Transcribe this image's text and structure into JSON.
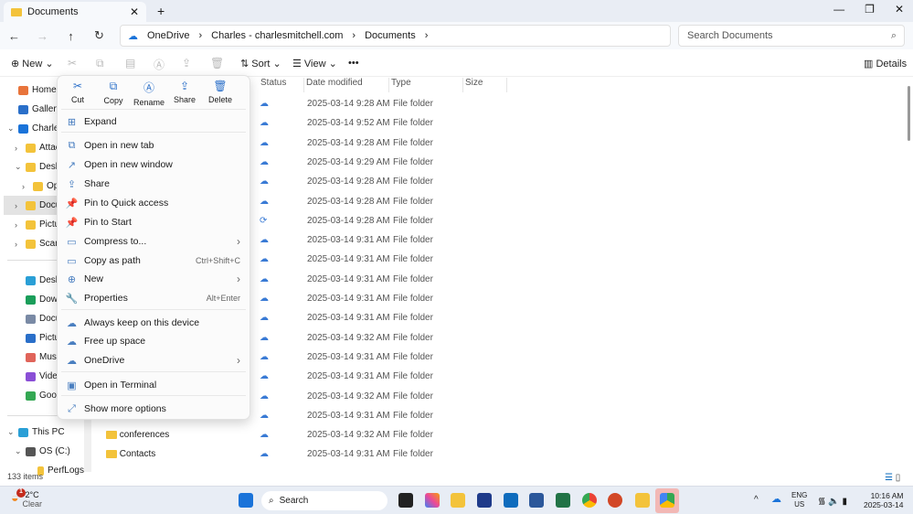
{
  "window": {
    "tab_title": "Documents",
    "new_tab": "+",
    "controls": [
      "—",
      "❐",
      "✕"
    ]
  },
  "nav": {
    "breadcrumb": [
      "OneDrive",
      "Charles - charlesmitchell.com",
      "Documents"
    ],
    "search_placeholder": "Search Documents"
  },
  "toolbar": {
    "new": "New",
    "sort": "Sort",
    "view": "View",
    "more": "•••",
    "details": "Details"
  },
  "sidebar": {
    "items": [
      {
        "label": "Home",
        "indent": 0,
        "icon": "home-icon"
      },
      {
        "label": "Gallery",
        "indent": 0,
        "icon": "gallery-icon"
      },
      {
        "label": "Charles",
        "indent": 0,
        "icon": "onedrive-icon",
        "chev": "⌄"
      },
      {
        "label": "Attach",
        "indent": 1,
        "icon": "folder-icon",
        "chev": "›"
      },
      {
        "label": "Deskto",
        "indent": 1,
        "icon": "folder-icon",
        "chev": "⌄"
      },
      {
        "label": "Ope",
        "indent": 2,
        "icon": "folder-icon",
        "chev": "›"
      },
      {
        "label": "Docum",
        "indent": 1,
        "icon": "folder-icon",
        "chev": "›",
        "selected": true
      },
      {
        "label": "Pictur",
        "indent": 1,
        "icon": "folder-icon",
        "chev": "›"
      },
      {
        "label": "Scans",
        "indent": 1,
        "icon": "folder-icon",
        "chev": "›"
      }
    ],
    "quick": [
      {
        "label": "Desktop",
        "icon": "desktop-icon"
      },
      {
        "label": "Downlo",
        "icon": "download-icon"
      },
      {
        "label": "Docum",
        "icon": "document-icon"
      },
      {
        "label": "Pictures",
        "icon": "pictures-icon"
      },
      {
        "label": "Music",
        "icon": "music-icon"
      },
      {
        "label": "Videos",
        "icon": "videos-icon"
      },
      {
        "label": "Google",
        "icon": "google-drive-icon"
      }
    ],
    "pc": [
      {
        "label": "This PC",
        "icon": "pc-icon",
        "chev": "⌄"
      },
      {
        "label": "OS (C:)",
        "icon": "drive-icon",
        "chev": "⌄"
      },
      {
        "label": "PerfLogs",
        "icon": "folder-icon"
      }
    ]
  },
  "columns": [
    "Status",
    "Date modified",
    "Type",
    "Size"
  ],
  "rows": [
    {
      "name": "",
      "date": "2025-03-14 9:28 AM",
      "type": "File folder",
      "status": "cloud"
    },
    {
      "name": "",
      "date": "2025-03-14 9:52 AM",
      "type": "File folder",
      "status": "cloud"
    },
    {
      "name": "",
      "date": "2025-03-14 9:28 AM",
      "type": "File folder",
      "status": "cloud"
    },
    {
      "name": "",
      "date": "2025-03-14 9:29 AM",
      "type": "File folder",
      "status": "cloud"
    },
    {
      "name": "",
      "date": "2025-03-14 9:28 AM",
      "type": "File folder",
      "status": "cloud"
    },
    {
      "name": "",
      "date": "2025-03-14 9:28 AM",
      "type": "File folder",
      "status": "cloud"
    },
    {
      "name": "",
      "date": "2025-03-14 9:28 AM",
      "type": "File folder",
      "status": "sync"
    },
    {
      "name": "",
      "date": "2025-03-14 9:31 AM",
      "type": "File folder",
      "status": "cloud"
    },
    {
      "name": "",
      "date": "2025-03-14 9:31 AM",
      "type": "File folder",
      "status": "cloud"
    },
    {
      "name": "",
      "date": "2025-03-14 9:31 AM",
      "type": "File folder",
      "status": "cloud"
    },
    {
      "name": "",
      "date": "2025-03-14 9:31 AM",
      "type": "File folder",
      "status": "cloud"
    },
    {
      "name": "",
      "date": "2025-03-14 9:31 AM",
      "type": "File folder",
      "status": "cloud"
    },
    {
      "name": "",
      "date": "2025-03-14 9:32 AM",
      "type": "File folder",
      "status": "cloud"
    },
    {
      "name": "",
      "date": "2025-03-14 9:31 AM",
      "type": "File folder",
      "status": "cloud"
    },
    {
      "name": "",
      "date": "2025-03-14 9:31 AM",
      "type": "File folder",
      "status": "cloud"
    },
    {
      "name": "",
      "date": "2025-03-14 9:32 AM",
      "type": "File folder",
      "status": "cloud"
    },
    {
      "name": "",
      "date": "2025-03-14 9:31 AM",
      "type": "File folder",
      "status": "cloud"
    },
    {
      "name": "conferences",
      "date": "2025-03-14 9:32 AM",
      "type": "File folder",
      "status": "cloud"
    },
    {
      "name": "Contacts",
      "date": "2025-03-14 9:31 AM",
      "type": "File folder",
      "status": "cloud"
    }
  ],
  "context_menu": {
    "quick_actions": [
      {
        "label": "Cut",
        "icon": "✂"
      },
      {
        "label": "Copy",
        "icon": "⧉"
      },
      {
        "label": "Rename",
        "icon": "Ⓐ"
      },
      {
        "label": "Share",
        "icon": "⇪"
      },
      {
        "label": "Delete",
        "icon": "🗑"
      }
    ],
    "items": [
      {
        "label": "Expand",
        "icon": "⊞"
      },
      {
        "label": "Open in new tab",
        "icon": "⧉",
        "sep": true
      },
      {
        "label": "Open in new window",
        "icon": "↗"
      },
      {
        "label": "Share",
        "icon": "⇪"
      },
      {
        "label": "Pin to Quick access",
        "icon": "📌"
      },
      {
        "label": "Pin to Start",
        "icon": "📌"
      },
      {
        "label": "Compress to...",
        "icon": "▭",
        "sub": "›"
      },
      {
        "label": "Copy as path",
        "icon": "▭",
        "shortcut": "Ctrl+Shift+C"
      },
      {
        "label": "New",
        "icon": "⊕",
        "sub": "›"
      },
      {
        "label": "Properties",
        "icon": "🔧",
        "shortcut": "Alt+Enter"
      },
      {
        "label": "Always keep on this device",
        "icon": "☁",
        "sep": true
      },
      {
        "label": "Free up space",
        "icon": "☁"
      },
      {
        "label": "OneDrive",
        "icon": "☁",
        "sub": "›"
      },
      {
        "label": "Open in Terminal",
        "icon": "▣",
        "sep": true
      },
      {
        "label": "Show more options",
        "icon": "⤢",
        "sep": true
      }
    ]
  },
  "status_bar": {
    "count": "133 items"
  },
  "taskbar": {
    "weather_temp": "-2°C",
    "weather_desc": "Clear",
    "weather_badge": "1",
    "search": "Search",
    "lang1": "ENG",
    "lang2": "US",
    "time": "10:16 AM",
    "date": "2025-03-14"
  },
  "colors": {
    "accent": "#0f6cbd",
    "folder": "#f3c33b",
    "onedrive": "#1a73d9"
  }
}
